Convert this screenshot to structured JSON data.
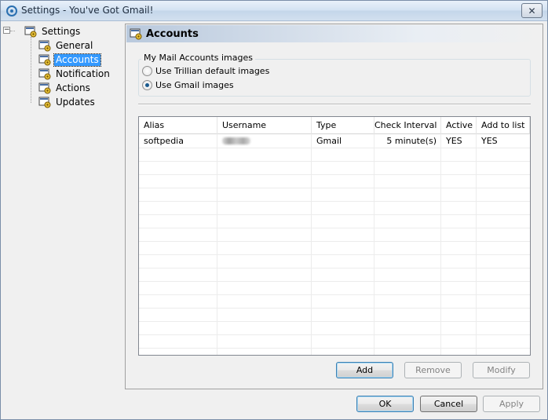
{
  "window": {
    "title": "Settings - You've Got Gmail!",
    "close_glyph": "✕"
  },
  "tree": {
    "root_label": "Settings",
    "expander_glyph": "−",
    "items": [
      {
        "label": "General"
      },
      {
        "label": "Accounts",
        "selected": true
      },
      {
        "label": "Notification"
      },
      {
        "label": "Actions"
      },
      {
        "label": "Updates"
      }
    ]
  },
  "panel": {
    "title": "Accounts",
    "images_group": {
      "legend": "My Mail Accounts images",
      "options": [
        {
          "label": "Use Trillian default images",
          "checked": false
        },
        {
          "label": "Use Gmail images",
          "checked": true
        }
      ]
    },
    "accounts_table": {
      "columns": [
        "Alias",
        "Username",
        "Type",
        "Check Interval",
        "Active",
        "Add to list"
      ],
      "rows": [
        {
          "alias": "softpedia",
          "username": "",
          "type": "Gmail",
          "check_interval": "5 minute(s)",
          "active": "YES",
          "add_to_list": "YES"
        }
      ]
    },
    "buttons": {
      "add": "Add",
      "remove": "Remove",
      "modify": "Modify"
    }
  },
  "footer": {
    "ok": "OK",
    "cancel": "Cancel",
    "apply": "Apply"
  },
  "colors": {
    "selection": "#3399ff",
    "default_button_border": "#3c7fb1"
  }
}
